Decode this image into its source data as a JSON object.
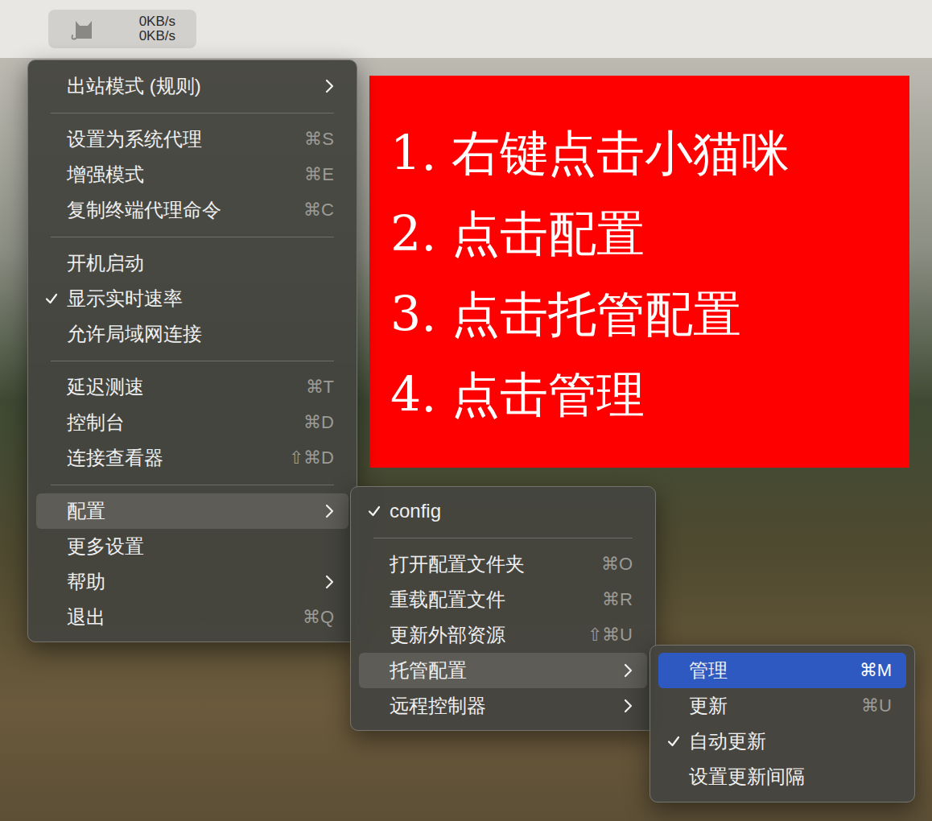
{
  "menu_bar": {
    "status_item": {
      "upload_rate": "0KB/s",
      "download_rate": "0KB/s"
    }
  },
  "main_menu": {
    "items": [
      {
        "kind": "item",
        "label": "出站模式 (规则)",
        "shortcut": "",
        "checked": false,
        "has_submenu": true,
        "selected": false
      },
      {
        "kind": "separator"
      },
      {
        "kind": "item",
        "label": "设置为系统代理",
        "shortcut": "⌘S",
        "checked": false,
        "has_submenu": false,
        "selected": false
      },
      {
        "kind": "item",
        "label": "增强模式",
        "shortcut": "⌘E",
        "checked": false,
        "has_submenu": false,
        "selected": false
      },
      {
        "kind": "item",
        "label": "复制终端代理命令",
        "shortcut": "⌘C",
        "checked": false,
        "has_submenu": false,
        "selected": false
      },
      {
        "kind": "separator"
      },
      {
        "kind": "item",
        "label": "开机启动",
        "shortcut": "",
        "checked": false,
        "has_submenu": false,
        "selected": false
      },
      {
        "kind": "item",
        "label": "显示实时速率",
        "shortcut": "",
        "checked": true,
        "has_submenu": false,
        "selected": false
      },
      {
        "kind": "item",
        "label": "允许局域网连接",
        "shortcut": "",
        "checked": false,
        "has_submenu": false,
        "selected": false
      },
      {
        "kind": "separator"
      },
      {
        "kind": "item",
        "label": "延迟测速",
        "shortcut": "⌘T",
        "checked": false,
        "has_submenu": false,
        "selected": false
      },
      {
        "kind": "item",
        "label": "控制台",
        "shortcut": "⌘D",
        "checked": false,
        "has_submenu": false,
        "selected": false
      },
      {
        "kind": "item",
        "label": "连接查看器",
        "shortcut": "⇧⌘D",
        "checked": false,
        "has_submenu": false,
        "selected": false
      },
      {
        "kind": "separator"
      },
      {
        "kind": "item",
        "label": "配置",
        "shortcut": "",
        "checked": false,
        "has_submenu": true,
        "selected": true
      },
      {
        "kind": "item",
        "label": "更多设置",
        "shortcut": "",
        "checked": false,
        "has_submenu": false,
        "selected": false
      },
      {
        "kind": "item",
        "label": "帮助",
        "shortcut": "",
        "checked": false,
        "has_submenu": true,
        "selected": false
      },
      {
        "kind": "item",
        "label": "退出",
        "shortcut": "⌘Q",
        "checked": false,
        "has_submenu": false,
        "selected": false
      }
    ]
  },
  "config_submenu": {
    "items": [
      {
        "kind": "item",
        "label": "config",
        "shortcut": "",
        "checked": true,
        "has_submenu": false,
        "selected": false
      },
      {
        "kind": "separator"
      },
      {
        "kind": "item",
        "label": "打开配置文件夹",
        "shortcut": "⌘O",
        "checked": false,
        "has_submenu": false,
        "selected": false
      },
      {
        "kind": "item",
        "label": "重载配置文件",
        "shortcut": "⌘R",
        "checked": false,
        "has_submenu": false,
        "selected": false
      },
      {
        "kind": "item",
        "label": "更新外部资源",
        "shortcut": "⇧⌘U",
        "checked": false,
        "has_submenu": false,
        "selected": false
      },
      {
        "kind": "item",
        "label": "托管配置",
        "shortcut": "",
        "checked": false,
        "has_submenu": true,
        "selected": true
      },
      {
        "kind": "item",
        "label": "远程控制器",
        "shortcut": "",
        "checked": false,
        "has_submenu": true,
        "selected": false
      }
    ]
  },
  "managed_config_submenu": {
    "items": [
      {
        "kind": "item",
        "label": "管理",
        "shortcut": "⌘M",
        "checked": false,
        "has_submenu": false,
        "selected": true
      },
      {
        "kind": "item",
        "label": "更新",
        "shortcut": "⌘U",
        "checked": false,
        "has_submenu": false,
        "selected": false
      },
      {
        "kind": "item",
        "label": "自动更新",
        "shortcut": "",
        "checked": true,
        "has_submenu": false,
        "selected": false
      },
      {
        "kind": "item",
        "label": "设置更新间隔",
        "shortcut": "",
        "checked": false,
        "has_submenu": false,
        "selected": false
      }
    ]
  },
  "instructions": [
    "1. 右键点击小猫咪",
    "2. 点击配置",
    "3. 点击托管配置",
    "4. 点击管理"
  ]
}
